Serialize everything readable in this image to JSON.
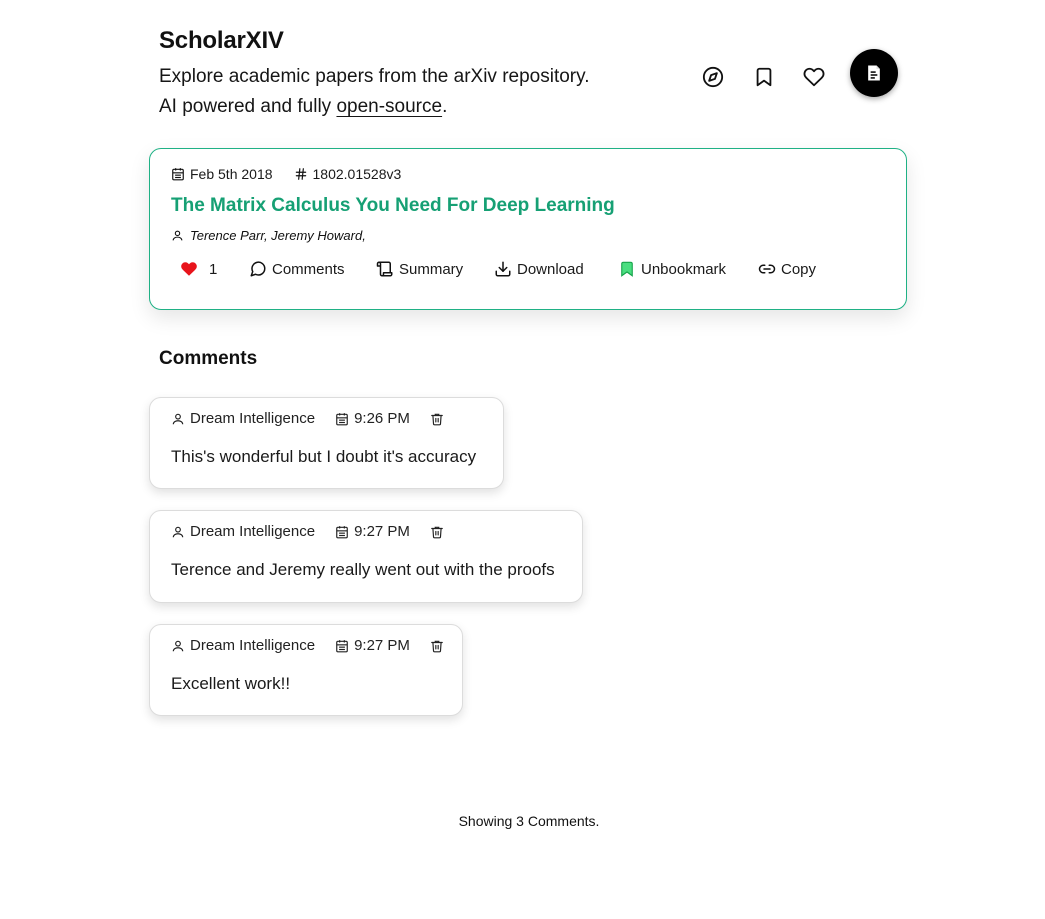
{
  "header": {
    "site_title": "ScholarXIV",
    "tagline_line1": "Explore academic papers from the arXiv repository.",
    "tagline_line2_prefix": "AI powered and fully ",
    "tagline_link": "open-source",
    "tagline_line2_suffix": ".",
    "nav_icons": [
      "compass-icon",
      "bookmark-icon",
      "heart-icon"
    ],
    "avatar_icon": "profile-avatar-icon"
  },
  "paper": {
    "date": "Feb 5th 2018",
    "arxiv_id": "1802.01528v3",
    "title": "The Matrix Calculus You Need For Deep Learning",
    "authors": "Terence Parr, Jeremy Howard,",
    "likes": "1",
    "actions": {
      "comments": "Comments",
      "summary": "Summary",
      "download": "Download",
      "unbookmark": "Unbookmark",
      "copy": "Copy"
    },
    "colors": {
      "accent": "#16a074",
      "border": "#1fb185",
      "like": "#e8141b",
      "bookmark_fill": "#4ade80"
    }
  },
  "comments": {
    "heading": "Comments",
    "items": [
      {
        "user": "Dream Intelligence",
        "time": "9:26 PM",
        "text": "This's wonderful but I doubt it's accuracy"
      },
      {
        "user": "Dream Intelligence",
        "time": "9:27 PM",
        "text": "Terence and Jeremy really went out with the proofs"
      },
      {
        "user": "Dream Intelligence",
        "time": "9:27 PM",
        "text": "Excellent work!!"
      }
    ],
    "status": "Showing 3 Comments."
  }
}
